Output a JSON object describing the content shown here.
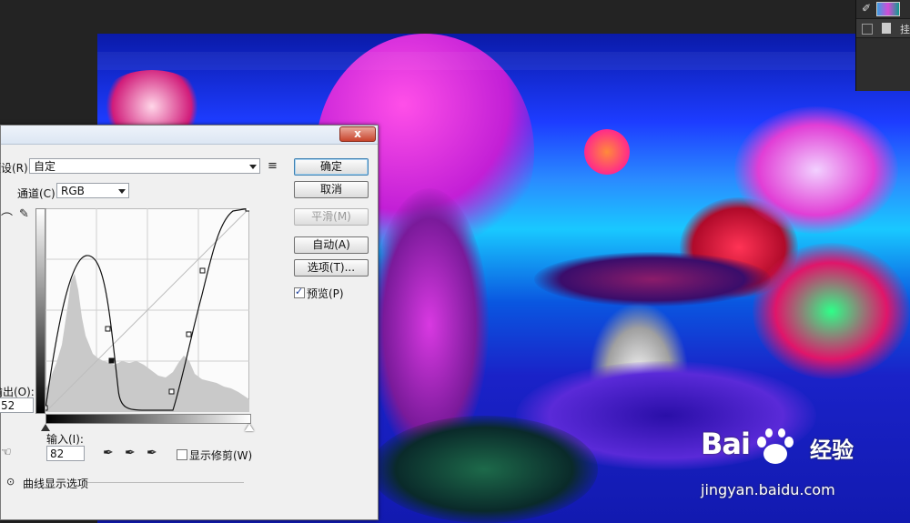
{
  "curves_dialog": {
    "preset_label": "预设(R):",
    "preset_value": "自定",
    "channel_label": "通道(C):",
    "channel_value": "RGB",
    "buttons": {
      "ok": "确定",
      "cancel": "取消",
      "smooth": "平滑(M)",
      "auto": "自动(A)",
      "options": "选项(T)..."
    },
    "preview_label": "预览(P)",
    "preview_checked": true,
    "output_label": "输出(O):",
    "output_value": "52",
    "input_label": "输入(I):",
    "input_value": "82",
    "show_clipping_label": "显示修剪(W)",
    "show_clipping_checked": false,
    "curve_display_options_label": "曲线显示选项",
    "close_glyph": "x"
  },
  "layers_panel": {
    "layer_label": "挂"
  },
  "watermark": {
    "brand": "Bai",
    "brand_suffix": "经验",
    "url": "jingyan.baidu.com"
  },
  "icons": [
    "close-icon",
    "preset-menu-icon",
    "curve-edit-icon",
    "pencil-icon",
    "hand-target-icon",
    "eyedropper-black-icon",
    "eyedropper-gray-icon",
    "eyedropper-white-icon",
    "expand-chevron-icon",
    "paw-logo-icon"
  ]
}
